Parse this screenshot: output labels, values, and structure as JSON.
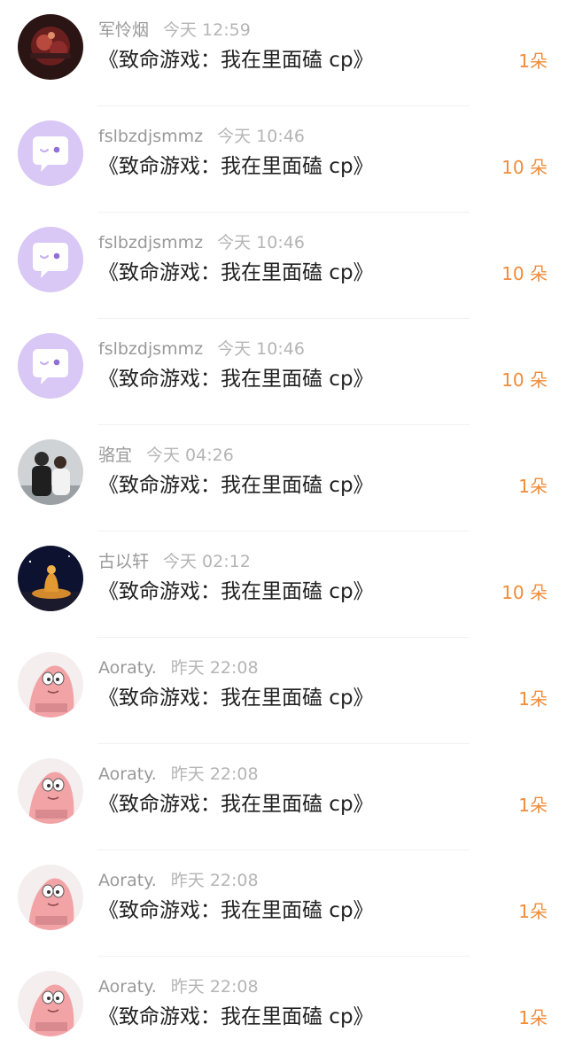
{
  "items": [
    {
      "name": "军怜烟",
      "time": "今天 12:59",
      "title": "《致命游戏：我在里面磕 cp》",
      "gift": "1朵",
      "avatar": "photo-red-icon"
    },
    {
      "name": "fslbzdjsmmz",
      "time": "今天 10:46",
      "title": "《致命游戏：我在里面磕 cp》",
      "gift": "10 朵",
      "avatar": "default-chat-bubble-icon"
    },
    {
      "name": "fslbzdjsmmz",
      "time": "今天 10:46",
      "title": "《致命游戏：我在里面磕 cp》",
      "gift": "10 朵",
      "avatar": "default-chat-bubble-icon"
    },
    {
      "name": "fslbzdjsmmz",
      "time": "今天 10:46",
      "title": "《致命游戏：我在里面磕 cp》",
      "gift": "10 朵",
      "avatar": "default-chat-bubble-icon"
    },
    {
      "name": "骆宜",
      "time": "今天 04:26",
      "title": "《致命游戏：我在里面磕 cp》",
      "gift": "1朵",
      "avatar": "couple-photo-icon"
    },
    {
      "name": "古以轩",
      "time": "今天 02:12",
      "title": "《致命游戏：我在里面磕 cp》",
      "gift": "10 朵",
      "avatar": "night-statue-icon"
    },
    {
      "name": "Aoraty.",
      "time": "昨天 22:08",
      "title": "《致命游戏：我在里面磕 cp》",
      "gift": "1朵",
      "avatar": "pink-cartoon-icon"
    },
    {
      "name": "Aoraty.",
      "time": "昨天 22:08",
      "title": "《致命游戏：我在里面磕 cp》",
      "gift": "1朵",
      "avatar": "pink-cartoon-icon"
    },
    {
      "name": "Aoraty.",
      "time": "昨天 22:08",
      "title": "《致命游戏：我在里面磕 cp》",
      "gift": "1朵",
      "avatar": "pink-cartoon-icon"
    },
    {
      "name": "Aoraty.",
      "time": "昨天 22:08",
      "title": "《致命游戏：我在里面磕 cp》",
      "gift": "1朵",
      "avatar": "pink-cartoon-icon"
    }
  ],
  "colors": {
    "gift": "#f08c3a",
    "name": "#999999",
    "title": "#222222",
    "default_avatar_bg": "#d9c7f5"
  }
}
